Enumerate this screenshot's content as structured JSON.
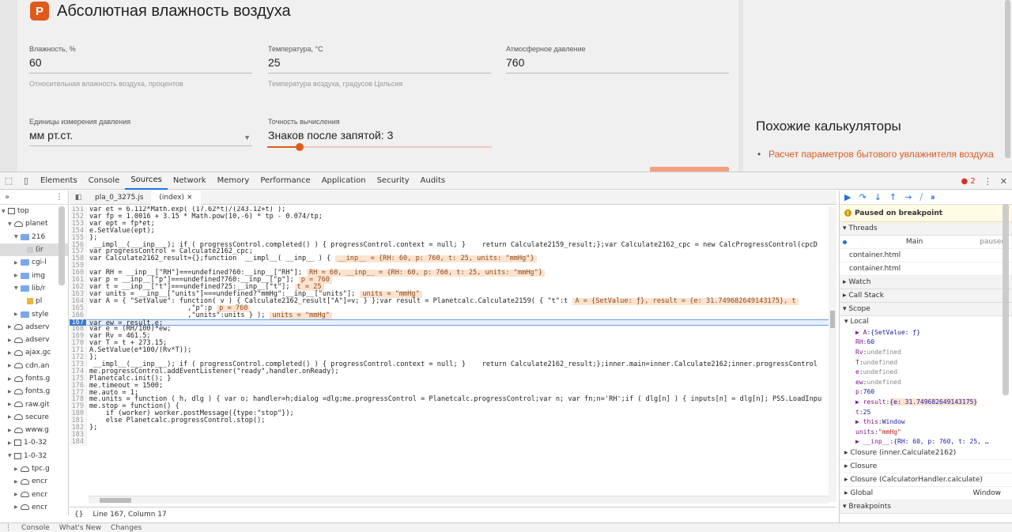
{
  "web": {
    "title": "Абсолютная влажность воздуха",
    "logo_letter": "P",
    "fields": [
      {
        "label": "Влажность, %",
        "value": "60",
        "help": "Относительная влажность воздуха, процентов"
      },
      {
        "label": "Температура, °C",
        "value": "25",
        "help": "Температура воздуха, градусов Цельсия"
      },
      {
        "label": "Атмосферное давление",
        "value": "760",
        "help": ""
      },
      {
        "label": "Единицы измерения давления",
        "value": "мм рт.ст.",
        "help": ""
      },
      {
        "label": "Точность вычисления",
        "value": "Знаков после запятой: 3",
        "help": ""
      }
    ],
    "similar_title": "Похожие калькуляторы",
    "similar_link": "Расчет параметров бытового увлажнителя воздуха"
  },
  "devtools": {
    "tabs": [
      "Elements",
      "Console",
      "Sources",
      "Network",
      "Memory",
      "Performance",
      "Application",
      "Security",
      "Audits"
    ],
    "active_tab": "Sources",
    "error_count": "2",
    "editor_tabs": [
      "pla_0_3275.js",
      "(index)"
    ],
    "status_text": "Line 167, Column 17",
    "tree": [
      {
        "indent": 0,
        "arrow": "▼",
        "icon": "frame",
        "label": "top"
      },
      {
        "indent": 1,
        "arrow": "▼",
        "icon": "cloud",
        "label": "planet"
      },
      {
        "indent": 2,
        "arrow": "▼",
        "icon": "folder",
        "label": "216"
      },
      {
        "indent": 3,
        "arrow": "",
        "icon": "file",
        "label": "(ir"
      },
      {
        "indent": 2,
        "arrow": "▶",
        "icon": "folder",
        "label": "cgi-l"
      },
      {
        "indent": 2,
        "arrow": "▶",
        "icon": "folder",
        "label": "img"
      },
      {
        "indent": 2,
        "arrow": "▼",
        "icon": "folder",
        "label": "lib/r"
      },
      {
        "indent": 3,
        "arrow": "",
        "icon": "ofile",
        "label": "pl"
      },
      {
        "indent": 2,
        "arrow": "▶",
        "icon": "folder",
        "label": "style"
      },
      {
        "indent": 1,
        "arrow": "▶",
        "icon": "cloud",
        "label": "adserv"
      },
      {
        "indent": 1,
        "arrow": "▶",
        "icon": "cloud",
        "label": "adserv"
      },
      {
        "indent": 1,
        "arrow": "▶",
        "icon": "cloud",
        "label": "ajax.gc"
      },
      {
        "indent": 1,
        "arrow": "▶",
        "icon": "cloud",
        "label": "cdn.an"
      },
      {
        "indent": 1,
        "arrow": "▶",
        "icon": "cloud",
        "label": "fonts.g"
      },
      {
        "indent": 1,
        "arrow": "▶",
        "icon": "cloud",
        "label": "fonts.g"
      },
      {
        "indent": 1,
        "arrow": "▶",
        "icon": "cloud",
        "label": "raw.git"
      },
      {
        "indent": 1,
        "arrow": "▶",
        "icon": "cloud",
        "label": "secure"
      },
      {
        "indent": 1,
        "arrow": "▶",
        "icon": "cloud",
        "label": "www.g"
      },
      {
        "indent": 1,
        "arrow": "▶",
        "icon": "frame",
        "label": "1-0-32"
      },
      {
        "indent": 1,
        "arrow": "▼",
        "icon": "frame",
        "label": "1-0-32"
      },
      {
        "indent": 2,
        "arrow": "▶",
        "icon": "cloud",
        "label": "tpc.g"
      },
      {
        "indent": 2,
        "arrow": "▶",
        "icon": "cloud",
        "label": "encr"
      },
      {
        "indent": 2,
        "arrow": "▶",
        "icon": "cloud",
        "label": "encr"
      },
      {
        "indent": 2,
        "arrow": "▶",
        "icon": "cloud",
        "label": "encr"
      }
    ],
    "code": [
      {
        "n": "151",
        "t": "var et = 6.112*Math.exp( (17.62*t)/(243.12+t) );",
        "i": ""
      },
      {
        "n": "152",
        "t": "var fp = 1.0016 + 3.15 * Math.pow(10,-6) * tp - 0.074/tp;",
        "i": ""
      },
      {
        "n": "153",
        "t": "var ept = fp*et;",
        "i": ""
      },
      {
        "n": "154",
        "t": "e.SetValue(ept);",
        "i": ""
      },
      {
        "n": "155",
        "t": "};",
        "i": ""
      },
      {
        "n": "156",
        "t": " __impl__(___inp___); if ( progressControl.completed() ) { progressControl.context = null; }    return Calculate2159_result;};var Calculate2162_cpc = new CalcProgressControl(cpcD",
        "i": ""
      },
      {
        "n": "157",
        "t": "var progressControl = Calculate2162_cpc;",
        "i": ""
      },
      {
        "n": "158",
        "t": "var Calculate2162_result={};function  __impl__( __inp__ ) {",
        "i": "__inp__ = {RH: 60, p: 760, t: 25, units: \"mmHg\"}"
      },
      {
        "n": "159",
        "t": "",
        "i": ""
      },
      {
        "n": "160",
        "t": "var RH = __inp__[\"RH\"]===undefined?60:__inp__[\"RH\"];",
        "i": "RH = 60, __inp__ = {RH: 60, p: 760, t: 25, units: \"mmHg\"}"
      },
      {
        "n": "161",
        "t": "var p = __inp__[\"p\"]===undefined?760:__inp__[\"p\"];",
        "i": "p = 760"
      },
      {
        "n": "162",
        "t": "var t = __inp__[\"t\"]===undefined?25:__inp__[\"t\"];",
        "i": "t = 25"
      },
      {
        "n": "163",
        "t": "var units = __inp__[\"units\"]===undefined?\"mmHg\":__inp__[\"units\"];",
        "i": "units = \"mmHg\""
      },
      {
        "n": "164",
        "t": "var A = { \"SetValue\": function( v ) { Calculate2162_result[\"A\"]=v; } };var result = Planetcalc.Calculate2159( { \"t\":t",
        "i": "A = {SetValue: ƒ}, result = {e: 31.749682649143175}, t"
      },
      {
        "n": "165",
        "t": "                        ,\"p\":p",
        "i": "p = 760"
      },
      {
        "n": "166",
        "t": "                        ,\"units\":units } );",
        "i": "units = \"mmHg\""
      },
      {
        "n": "167",
        "t": "var ew = result.e;",
        "i": "",
        "cur": true
      },
      {
        "n": "168",
        "t": "var e = (RH/100)*ew;",
        "i": ""
      },
      {
        "n": "169",
        "t": "var Rv = 461.5;",
        "i": ""
      },
      {
        "n": "170",
        "t": "var T = t + 273.15;",
        "i": ""
      },
      {
        "n": "171",
        "t": "A.SetValue(e*100/(Rv*T));",
        "i": ""
      },
      {
        "n": "172",
        "t": "};",
        "i": ""
      },
      {
        "n": "173",
        "t": " __impl__(___inp___); if ( progressControl.completed() ) { progressControl.context = null; }    return Calculate2162_result;};inner.main=inner.Calculate2162;inner.progressControl",
        "i": ""
      },
      {
        "n": "174",
        "t": "me.progressControl.addEventListener(\"ready\",handler.onReady);",
        "i": ""
      },
      {
        "n": "175",
        "t": "Planetcalc.init(); }",
        "i": ""
      },
      {
        "n": "176",
        "t": "me.timeout = 1500;",
        "i": ""
      },
      {
        "n": "177",
        "t": "me.auto = 1;",
        "i": ""
      },
      {
        "n": "178",
        "t": "me.units = function ( h, dlg ) { var o; handler=h;dialog =dlg;me.progressControl = Planetcalc.progressControl;var n; var fn;n='RH';if ( dlg[n] ) { inputs[n] = dlg[n]; PSS.LoadInpu",
        "i": ""
      },
      {
        "n": "179",
        "t": "me.stop = function() {",
        "i": ""
      },
      {
        "n": "180",
        "t": "    if (worker) worker.postMessage({type:\"stop\"});",
        "i": ""
      },
      {
        "n": "181",
        "t": "    else Planetcalc.progressControl.stop();",
        "i": ""
      },
      {
        "n": "182",
        "t": "};",
        "i": ""
      },
      {
        "n": "183",
        "t": "",
        "i": ""
      },
      {
        "n": "184",
        "t": "",
        "i": ""
      }
    ],
    "debugger": {
      "paused_label": "Paused on breakpoint",
      "threads_label": "Threads",
      "threads": [
        {
          "name": "Main",
          "state": "paused"
        },
        {
          "name": "container.html",
          "state": ""
        },
        {
          "name": "container.html",
          "state": ""
        }
      ],
      "watch_label": "Watch",
      "callstack_label": "Call Stack",
      "scope_label": "Scope",
      "local_label": "Local",
      "locals": [
        {
          "k": "▶ A",
          "v": "{SetValue: ƒ}",
          "cls": ""
        },
        {
          "k": "RH",
          "v": "60",
          "cls": ""
        },
        {
          "k": "Rv",
          "v": "undefined",
          "cls": "u"
        },
        {
          "k": "T",
          "v": "undefined",
          "cls": "u"
        },
        {
          "k": "e",
          "v": "undefined",
          "cls": "u"
        },
        {
          "k": "ew",
          "v": "undefined",
          "cls": "u"
        },
        {
          "k": "p",
          "v": "760",
          "cls": ""
        },
        {
          "k": "▶ result",
          "v": "{e: 31.749682649143175}",
          "cls": "hl"
        },
        {
          "k": "t",
          "v": "25",
          "cls": ""
        },
        {
          "k": "▶ this",
          "v": "Window",
          "cls": ""
        },
        {
          "k": "units",
          "v": "\"mmHg\"",
          "cls": "s"
        },
        {
          "k": "▶ __inp__",
          "v": "{RH: 60, p: 760, t: 25, …",
          "cls": ""
        }
      ],
      "closures": [
        {
          "name": "Closure (inner.Calculate2162)",
          "right": ""
        },
        {
          "name": "Closure",
          "right": ""
        },
        {
          "name": "Closure (CalculatorHandler.calculate)",
          "right": ""
        },
        {
          "name": "Global",
          "right": "Window"
        }
      ],
      "breakpoints_label": "Breakpoints"
    },
    "bottom_tabs": [
      "Console",
      "What's New",
      "Changes"
    ]
  }
}
